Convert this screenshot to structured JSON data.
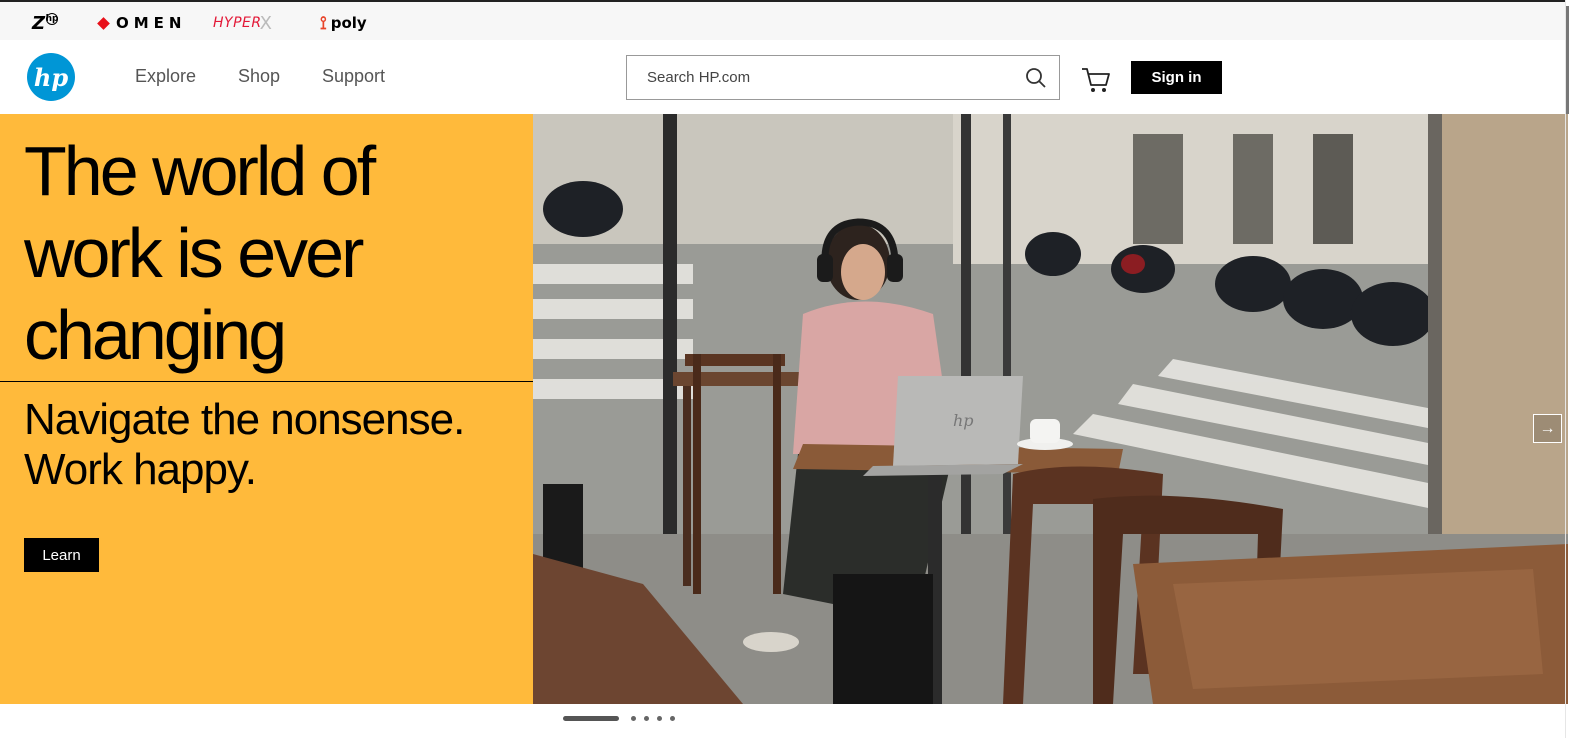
{
  "brands": {
    "z_label": "Z",
    "z_sub": "hp",
    "omen_label": "OMEN",
    "hyperx_label": "HYPER",
    "hyperx_x": "X",
    "poly_label": "poly"
  },
  "header": {
    "logo_text": "hp",
    "nav": [
      "Explore",
      "Shop",
      "Support"
    ],
    "search_placeholder": "Search HP.com",
    "signin_label": "Sign in"
  },
  "hero": {
    "headline": "The world of work is ever changing",
    "subhead_line1": "Navigate the nonsense.",
    "subhead_line2": "Work happy.",
    "cta_label": "Learn",
    "next_arrow": "→",
    "accent_color": "#ffba3b"
  },
  "carousel": {
    "slide_count": 5,
    "active_index": 0
  },
  "icons": {
    "search": "search-icon",
    "cart": "cart-icon",
    "next": "arrow-right-icon"
  }
}
